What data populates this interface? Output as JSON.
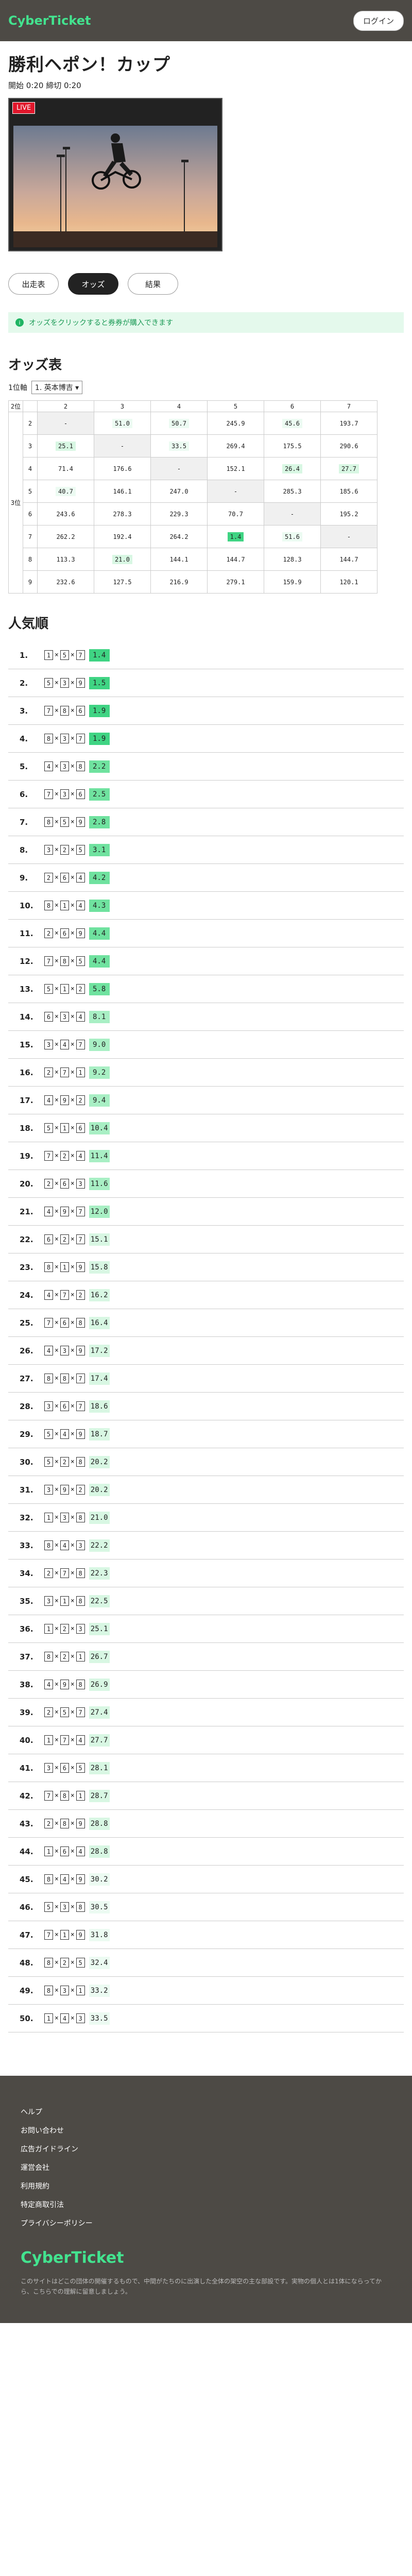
{
  "header": {
    "logo": "CyberTicket",
    "login": "ログイン"
  },
  "race": {
    "title": "勝利ヘポン！カップ",
    "meta": "開始 0:20 締切 0:20"
  },
  "video": {
    "live": "LIVE"
  },
  "tabs": [
    {
      "label": "出走表",
      "active": false
    },
    {
      "label": "オッズ",
      "active": true
    },
    {
      "label": "結果",
      "active": false
    }
  ],
  "notice": "オッズをクリックすると券券が購入できます",
  "odds": {
    "title": "オッズ表",
    "first_label": "1位軸",
    "first_value": "1. 英本博吉",
    "second_label": "2位",
    "third_label": "3位",
    "cols": [
      "2",
      "3",
      "4",
      "5",
      "6",
      "7"
    ],
    "rows": [
      {
        "r": "2",
        "v": [
          "-",
          "51.0",
          "50.7",
          "245.9",
          "45.6",
          "193.7"
        ]
      },
      {
        "r": "3",
        "v": [
          "25.1",
          "-",
          "33.5",
          "269.4",
          "175.5",
          "290.6"
        ]
      },
      {
        "r": "4",
        "v": [
          "71.4",
          "176.6",
          "-",
          "152.1",
          "26.4",
          "27.7"
        ]
      },
      {
        "r": "5",
        "v": [
          "40.7",
          "146.1",
          "247.0",
          "-",
          "285.3",
          "185.6"
        ]
      },
      {
        "r": "6",
        "v": [
          "243.6",
          "278.3",
          "229.3",
          "70.7",
          "-",
          "195.2"
        ]
      },
      {
        "r": "7",
        "v": [
          "262.2",
          "192.4",
          "264.2",
          "1.4",
          "51.6",
          "-"
        ]
      },
      {
        "r": "8",
        "v": [
          "113.3",
          "21.0",
          "144.1",
          "144.7",
          "128.3",
          "144.7"
        ]
      },
      {
        "r": "9",
        "v": [
          "232.6",
          "127.5",
          "216.9",
          "279.1",
          "159.9",
          "120.1"
        ]
      }
    ]
  },
  "popular": {
    "title": "人気順",
    "items": [
      {
        "rank": "1.",
        "n": [
          "1",
          "5",
          "7"
        ],
        "odd": "1.4"
      },
      {
        "rank": "2.",
        "n": [
          "5",
          "3",
          "9"
        ],
        "odd": "1.5"
      },
      {
        "rank": "3.",
        "n": [
          "7",
          "8",
          "6"
        ],
        "odd": "1.9"
      },
      {
        "rank": "4.",
        "n": [
          "8",
          "3",
          "7"
        ],
        "odd": "1.9"
      },
      {
        "rank": "5.",
        "n": [
          "4",
          "3",
          "8"
        ],
        "odd": "2.2"
      },
      {
        "rank": "6.",
        "n": [
          "7",
          "3",
          "6"
        ],
        "odd": "2.5"
      },
      {
        "rank": "7.",
        "n": [
          "8",
          "5",
          "9"
        ],
        "odd": "2.8"
      },
      {
        "rank": "8.",
        "n": [
          "3",
          "2",
          "5"
        ],
        "odd": "3.1"
      },
      {
        "rank": "9.",
        "n": [
          "2",
          "6",
          "4"
        ],
        "odd": "4.2"
      },
      {
        "rank": "10.",
        "n": [
          "8",
          "1",
          "4"
        ],
        "odd": "4.3"
      },
      {
        "rank": "11.",
        "n": [
          "2",
          "6",
          "9"
        ],
        "odd": "4.4"
      },
      {
        "rank": "12.",
        "n": [
          "7",
          "8",
          "5"
        ],
        "odd": "4.4"
      },
      {
        "rank": "13.",
        "n": [
          "5",
          "1",
          "2"
        ],
        "odd": "5.8"
      },
      {
        "rank": "14.",
        "n": [
          "6",
          "3",
          "4"
        ],
        "odd": "8.1"
      },
      {
        "rank": "15.",
        "n": [
          "3",
          "4",
          "7"
        ],
        "odd": "9.0"
      },
      {
        "rank": "16.",
        "n": [
          "2",
          "7",
          "1"
        ],
        "odd": "9.2"
      },
      {
        "rank": "17.",
        "n": [
          "4",
          "9",
          "2"
        ],
        "odd": "9.4"
      },
      {
        "rank": "18.",
        "n": [
          "5",
          "1",
          "6"
        ],
        "odd": "10.4"
      },
      {
        "rank": "19.",
        "n": [
          "7",
          "2",
          "4"
        ],
        "odd": "11.4"
      },
      {
        "rank": "20.",
        "n": [
          "2",
          "6",
          "3"
        ],
        "odd": "11.6"
      },
      {
        "rank": "21.",
        "n": [
          "4",
          "9",
          "7"
        ],
        "odd": "12.0"
      },
      {
        "rank": "22.",
        "n": [
          "6",
          "2",
          "7"
        ],
        "odd": "15.1"
      },
      {
        "rank": "23.",
        "n": [
          "8",
          "1",
          "9"
        ],
        "odd": "15.8"
      },
      {
        "rank": "24.",
        "n": [
          "4",
          "7",
          "2"
        ],
        "odd": "16.2"
      },
      {
        "rank": "25.",
        "n": [
          "7",
          "6",
          "8"
        ],
        "odd": "16.4"
      },
      {
        "rank": "26.",
        "n": [
          "4",
          "3",
          "9"
        ],
        "odd": "17.2"
      },
      {
        "rank": "27.",
        "n": [
          "8",
          "8",
          "7"
        ],
        "odd": "17.4"
      },
      {
        "rank": "28.",
        "n": [
          "3",
          "6",
          "7"
        ],
        "odd": "18.6"
      },
      {
        "rank": "29.",
        "n": [
          "5",
          "4",
          "9"
        ],
        "odd": "18.7"
      },
      {
        "rank": "30.",
        "n": [
          "5",
          "2",
          "8"
        ],
        "odd": "20.2"
      },
      {
        "rank": "31.",
        "n": [
          "3",
          "9",
          "2"
        ],
        "odd": "20.2"
      },
      {
        "rank": "32.",
        "n": [
          "1",
          "3",
          "8"
        ],
        "odd": "21.0"
      },
      {
        "rank": "33.",
        "n": [
          "8",
          "4",
          "3"
        ],
        "odd": "22.2"
      },
      {
        "rank": "34.",
        "n": [
          "2",
          "7",
          "8"
        ],
        "odd": "22.3"
      },
      {
        "rank": "35.",
        "n": [
          "3",
          "1",
          "8"
        ],
        "odd": "22.5"
      },
      {
        "rank": "36.",
        "n": [
          "1",
          "2",
          "3"
        ],
        "odd": "25.1"
      },
      {
        "rank": "37.",
        "n": [
          "8",
          "2",
          "1"
        ],
        "odd": "26.7"
      },
      {
        "rank": "38.",
        "n": [
          "4",
          "9",
          "8"
        ],
        "odd": "26.9"
      },
      {
        "rank": "39.",
        "n": [
          "2",
          "5",
          "7"
        ],
        "odd": "27.4"
      },
      {
        "rank": "40.",
        "n": [
          "1",
          "7",
          "4"
        ],
        "odd": "27.7"
      },
      {
        "rank": "41.",
        "n": [
          "3",
          "6",
          "5"
        ],
        "odd": "28.1"
      },
      {
        "rank": "42.",
        "n": [
          "7",
          "8",
          "1"
        ],
        "odd": "28.7"
      },
      {
        "rank": "43.",
        "n": [
          "2",
          "8",
          "9"
        ],
        "odd": "28.8"
      },
      {
        "rank": "44.",
        "n": [
          "1",
          "6",
          "4"
        ],
        "odd": "28.8"
      },
      {
        "rank": "45.",
        "n": [
          "8",
          "4",
          "9"
        ],
        "odd": "30.2"
      },
      {
        "rank": "46.",
        "n": [
          "5",
          "3",
          "8"
        ],
        "odd": "30.5"
      },
      {
        "rank": "47.",
        "n": [
          "7",
          "1",
          "9"
        ],
        "odd": "31.8"
      },
      {
        "rank": "48.",
        "n": [
          "8",
          "2",
          "5"
        ],
        "odd": "32.4"
      },
      {
        "rank": "49.",
        "n": [
          "8",
          "3",
          "1"
        ],
        "odd": "33.2"
      },
      {
        "rank": "50.",
        "n": [
          "1",
          "4",
          "3"
        ],
        "odd": "33.5"
      }
    ]
  },
  "footer": {
    "links": [
      "ヘルプ",
      "お問い合わせ",
      "広告ガイドライン",
      "運営会社",
      "利用規約",
      "特定商取引法",
      "プライバシーポリシー"
    ],
    "logo": "CyberTicket",
    "note": "このサイトはどこの団体の開催するもので、中間がたちのに出演した全体の架空の主な部設です。実物の個人とは1体にならってから、こちらでの理解に留意しましょう。"
  }
}
